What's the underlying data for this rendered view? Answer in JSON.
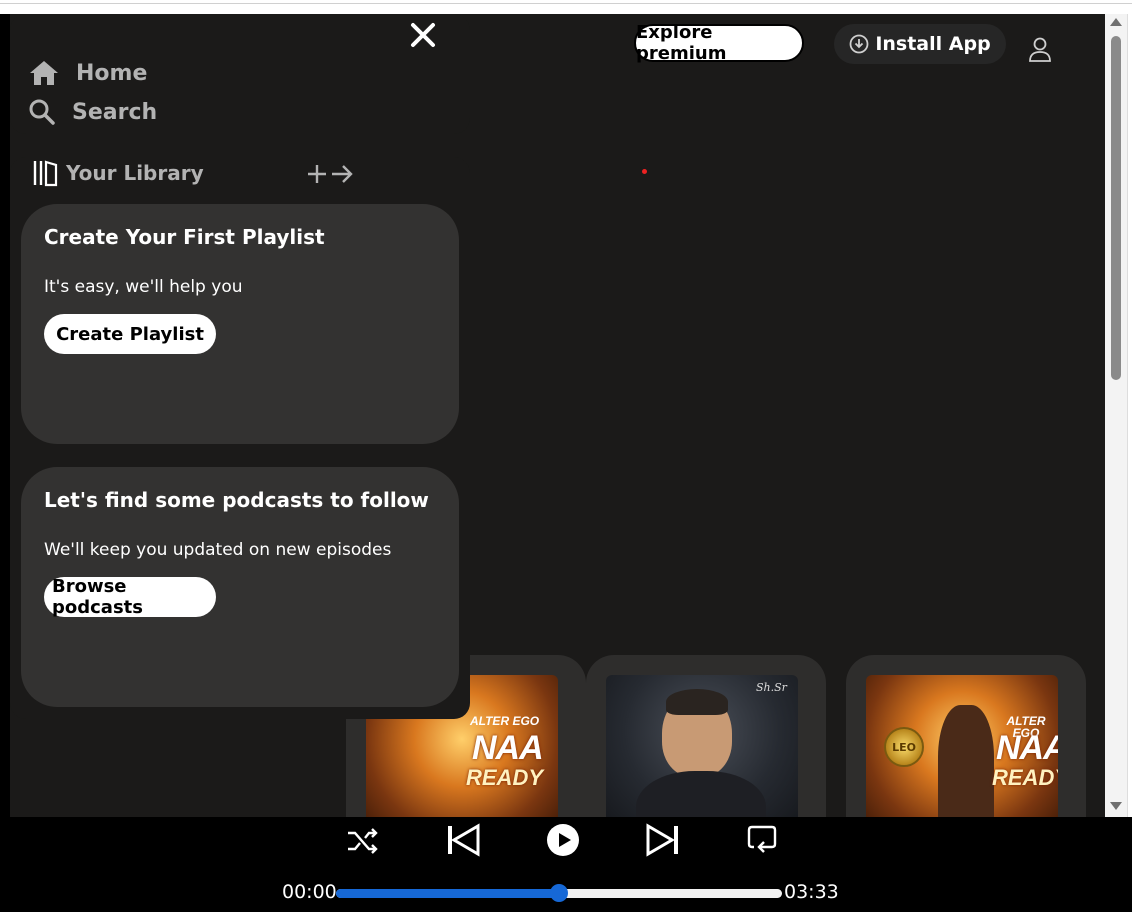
{
  "header": {
    "explore_premium_label": "Explore premium",
    "install_app_label": "Install App"
  },
  "nav": {
    "items": [
      {
        "label": "Home",
        "icon": "home-icon"
      },
      {
        "label": "Search",
        "icon": "search-icon"
      }
    ]
  },
  "library": {
    "title": "Your Library",
    "cards": [
      {
        "title": "Create Your First Playlist",
        "subtitle": "It's easy, we'll help you",
        "button": "Create Playlist"
      },
      {
        "title": "Let's find some podcasts to follow",
        "subtitle": "We'll keep you updated on new episodes",
        "button": "Browse podcasts"
      }
    ]
  },
  "albums": [
    {
      "art_text": [
        "ALTER EGO",
        "NAA",
        "READY"
      ]
    },
    {
      "art_text": []
    },
    {
      "art_text": [
        "ALTER EGO",
        "NAA",
        "READY",
        "LEO"
      ]
    }
  ],
  "player": {
    "current_time": "00:00",
    "total_time": "03:33",
    "progress": 0.5
  },
  "colors": {
    "background": "#1b1a19",
    "card": "#333231",
    "accent": "#1668d6"
  }
}
